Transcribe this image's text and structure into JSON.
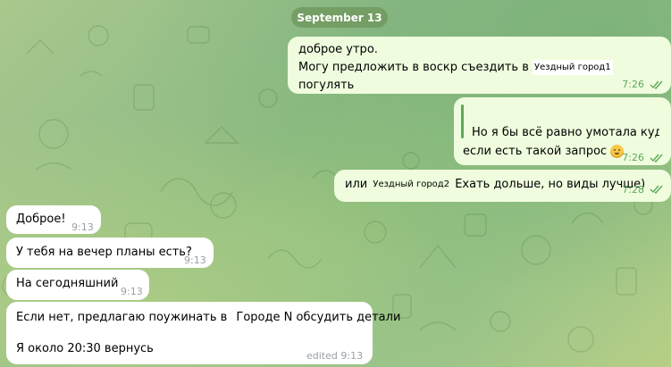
{
  "date_separator": "September 13",
  "outgoing": [
    {
      "line1": "доброе утро.",
      "line2_prefix": "Могу предложить в воскр съездить в",
      "chip": "Уездный город1",
      "line2_suffix": "погулять",
      "time": "7:26"
    },
    {
      "reply_quote": "Но я бы всё равно умотала куд...",
      "text": "если есть такой запрос",
      "time": "7:26"
    },
    {
      "prefix": "или",
      "chip": "Уездный город2",
      "suffix": "Ехать дольше, но виды лучше)",
      "time": "7:28"
    }
  ],
  "incoming": [
    {
      "text": "Доброе!",
      "time": "9:13"
    },
    {
      "text": "У тебя на вечер планы есть?",
      "time": "9:13"
    },
    {
      "text": "На сегодняшний",
      "time": "9:13"
    },
    {
      "line1_prefix": "Если нет, предлагаю поужинать в",
      "place": "Городе N",
      "line1_suffix": "обсудить детали",
      "line2": "Я около 20:30 вернусь",
      "time": "edited 9:13"
    }
  ]
}
